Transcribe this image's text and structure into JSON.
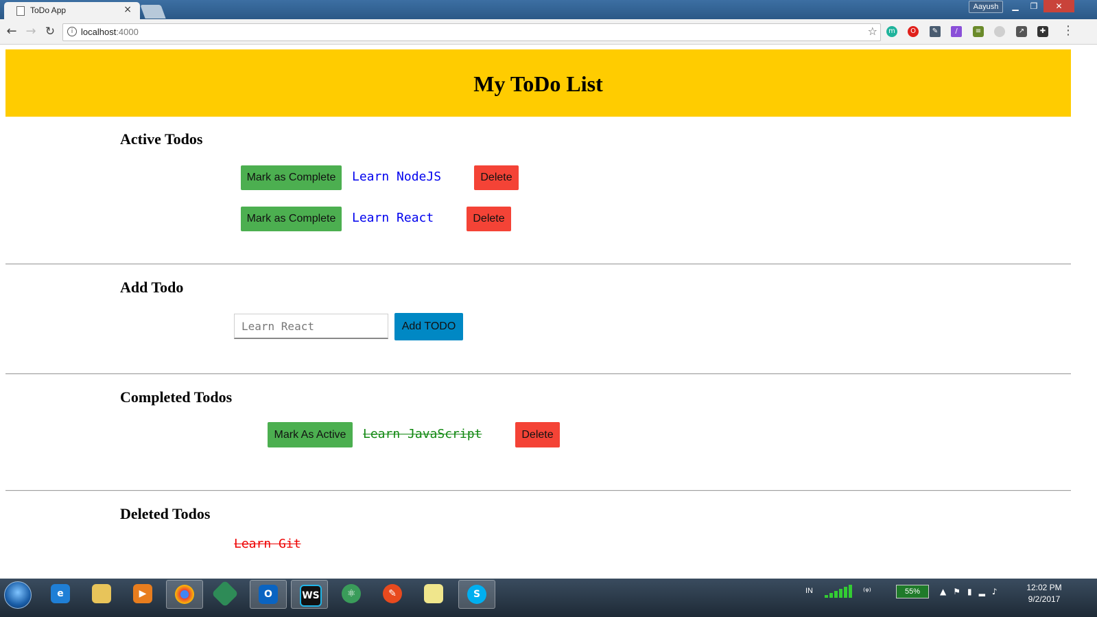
{
  "browser": {
    "tab_title": "ToDo App",
    "tab_close": "×",
    "user_name": "Aayush",
    "url_host": "localhost",
    "url_port": ":4000"
  },
  "page": {
    "title": "My ToDo List",
    "active_section_title": "Active Todos",
    "add_section_title": "Add Todo",
    "completed_section_title": "Completed Todos",
    "deleted_section_title": "Deleted Todos"
  },
  "active_todos": [
    {
      "action_label": "Mark as Complete",
      "text": "Learn NodeJS",
      "delete_label": "Delete"
    },
    {
      "action_label": "Mark as Complete",
      "text": "Learn React",
      "delete_label": "Delete"
    }
  ],
  "add_todo": {
    "placeholder": "Learn React",
    "button_label": "Add TODO"
  },
  "completed_todos": [
    {
      "action_label": "Mark As Active",
      "text": "Learn JavaScript",
      "delete_label": "Delete"
    }
  ],
  "deleted_todos": [
    {
      "text": "Learn Git"
    }
  ],
  "taskbar": {
    "language": "IN",
    "battery": "55%",
    "time": "12:02 PM",
    "date": "9/2/2017",
    "apps": [
      "internet-explorer",
      "file-explorer",
      "media-player",
      "chrome",
      "git",
      "outlook",
      "webstorm",
      "atom",
      "brush-app",
      "sticky-notes",
      "skype"
    ]
  },
  "colors": {
    "header": "#ffcc00",
    "green_button": "#4caf50",
    "red_button": "#f44336",
    "blue_button": "#0088c4",
    "active_text": "#0000ee",
    "completed_text": "#118811",
    "deleted_text": "#ee0000"
  }
}
